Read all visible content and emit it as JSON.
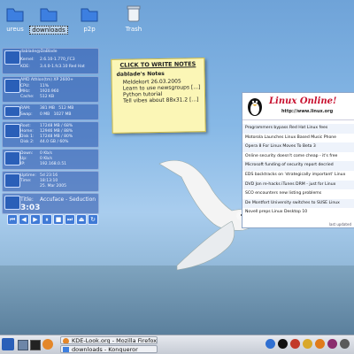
{
  "desktop": {
    "icons": [
      {
        "label": "ureus"
      },
      {
        "label": "downloads"
      },
      {
        "label": "p2p"
      },
      {
        "label": "Trash"
      }
    ]
  },
  "sysmon": {
    "user": "dablade@DaBlade",
    "kernel": {
      "k": "Kernel:",
      "v": "2.6.10-1.770_FC3"
    },
    "kde": {
      "k": "KDE:",
      "v": "3.4.0-1.fc3.10 Red Hat"
    },
    "cpu_name": "AMD Athlon(tm) XP 2600+",
    "cpu": {
      "k": "CPU:",
      "v": "11%"
    },
    "mhz": {
      "k": "MHz:",
      "v": "1920.960"
    },
    "cache": {
      "k": "Cache:",
      "v": "512 KB"
    },
    "ram": {
      "k": "RAM:",
      "v": "381 MB",
      "v2": "512 MB"
    },
    "swap": {
      "k": "Swap:",
      "v": "0 MB",
      "v2": "1027 MB"
    },
    "disks": [
      {
        "k": "Root:",
        "v": "17248 MB",
        "p": "68%"
      },
      {
        "k": "Home:",
        "v": "12946 MB",
        "p": "88%"
      },
      {
        "k": "Disk 1:",
        "v": "17248 MB",
        "p": "80%"
      },
      {
        "k": "Disk 2:",
        "v": "44.0 GB",
        "p": "60%"
      }
    ],
    "net": [
      {
        "k": "Down:",
        "v": "0 Kb/s"
      },
      {
        "k": "Up:",
        "v": "0 Kb/s"
      },
      {
        "k": "IP:",
        "v": "192.168.0.51"
      }
    ],
    "time": [
      {
        "k": "Uptime:",
        "v": "5d 23:16"
      },
      {
        "k": "Time:",
        "v": "18:13:10"
      },
      {
        "k": "",
        "v": "25. Mar 2005"
      }
    ],
    "title": {
      "k": "Title:",
      "v": "Accuface - Seduction"
    },
    "clock": "3:03",
    "media_buttons": [
      "⏮",
      "◀",
      "▶",
      "⏸",
      "■",
      "⏭",
      "⏏",
      "↻"
    ]
  },
  "note": {
    "header": "CLICK TO WRITE NOTES",
    "title": "dablade's Notes",
    "lines": [
      "Meldekort 26.03.2005",
      "Learn to use newsgroups  [...]",
      "Python tutorial",
      "Tell vibes about 88x31.2  [...]"
    ]
  },
  "linuxonline": {
    "logo": "Linux Online!",
    "url": "http://www.linux.org",
    "items": [
      "Programmers bypass Red Hat Linux fees",
      "Motorola Launches Linux Based Music Phone",
      "Opera 8 For Linux Moves To Beta 3",
      "Online security doesn't come cheap - it's free",
      "Microsoft funding of security report decried",
      "EDS backtracks on 'strategically important' Linux",
      "DVD Jon re-hacks iTunes DRM - just for Linux",
      "SCO encounters new listing problems",
      "De Montfort University switches to SUSE Linux",
      "Novell preps Linux Desktop 10"
    ],
    "footer": "last updated"
  },
  "taskbar": {
    "tasks": [
      "KDE-Look.org - Mozilla Firefox",
      "downloads - Konqueror"
    ]
  },
  "colors": {
    "accent": "#2a5fb8",
    "note": "#fbf6b6",
    "lo_red": "#c8102e"
  }
}
